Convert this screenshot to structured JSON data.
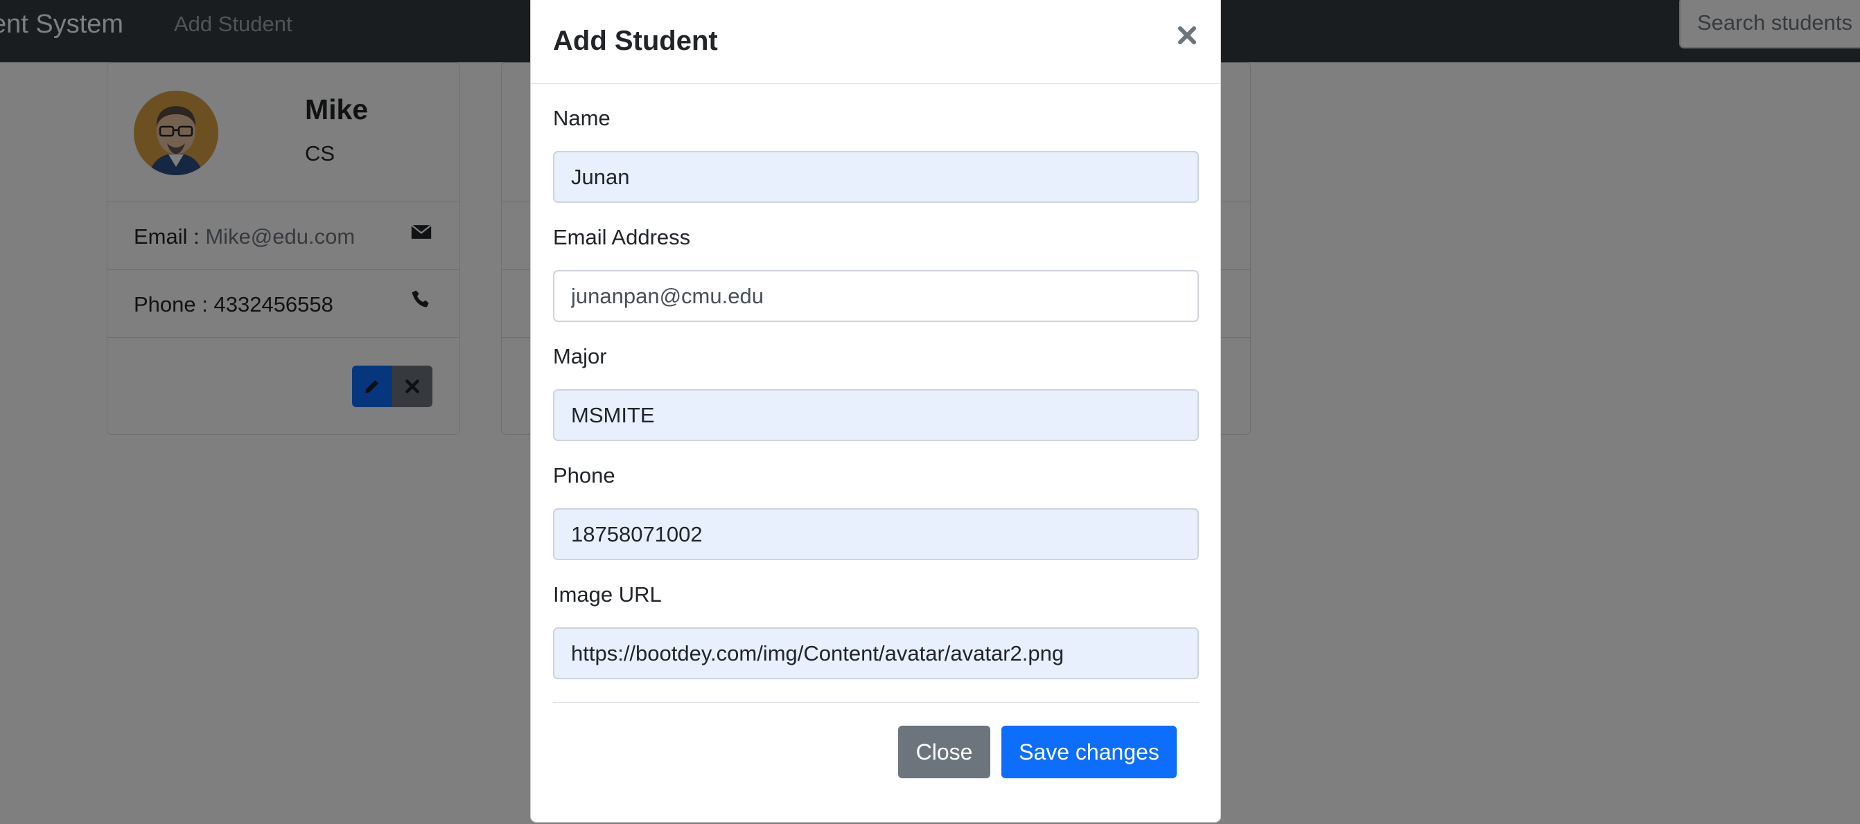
{
  "navbar": {
    "brand": "ent System",
    "add_student_link": "Add Student",
    "search_placeholder": "Search students"
  },
  "cards": [
    {
      "name": "Mike",
      "major": "CS",
      "email_label": "Email : ",
      "email": "Mike@edu.com",
      "phone_label": "Phone : ",
      "phone": "4332456558"
    }
  ],
  "modal": {
    "title": "Add Student",
    "fields": [
      {
        "label": "Name",
        "value": "Junan"
      },
      {
        "label": "Email Address",
        "value": "junanpan@cmu.edu"
      },
      {
        "label": "Major",
        "value": "MSMITE"
      },
      {
        "label": "Phone",
        "value": "18758071002"
      },
      {
        "label": "Image URL",
        "value": "https://bootdey.com/img/Content/avatar/avatar2.png"
      }
    ],
    "close_label": "Close",
    "save_label": "Save changes"
  },
  "colors": {
    "navbar": "#343a40",
    "primary": "#0d6efd",
    "secondary": "#6c757d",
    "autofill": "#e8f0fe",
    "backdrop": "rgba(0,0,0,0.5)"
  },
  "icons": [
    "envelope-icon",
    "phone-icon",
    "pencil-icon",
    "x-icon",
    "close-icon"
  ]
}
